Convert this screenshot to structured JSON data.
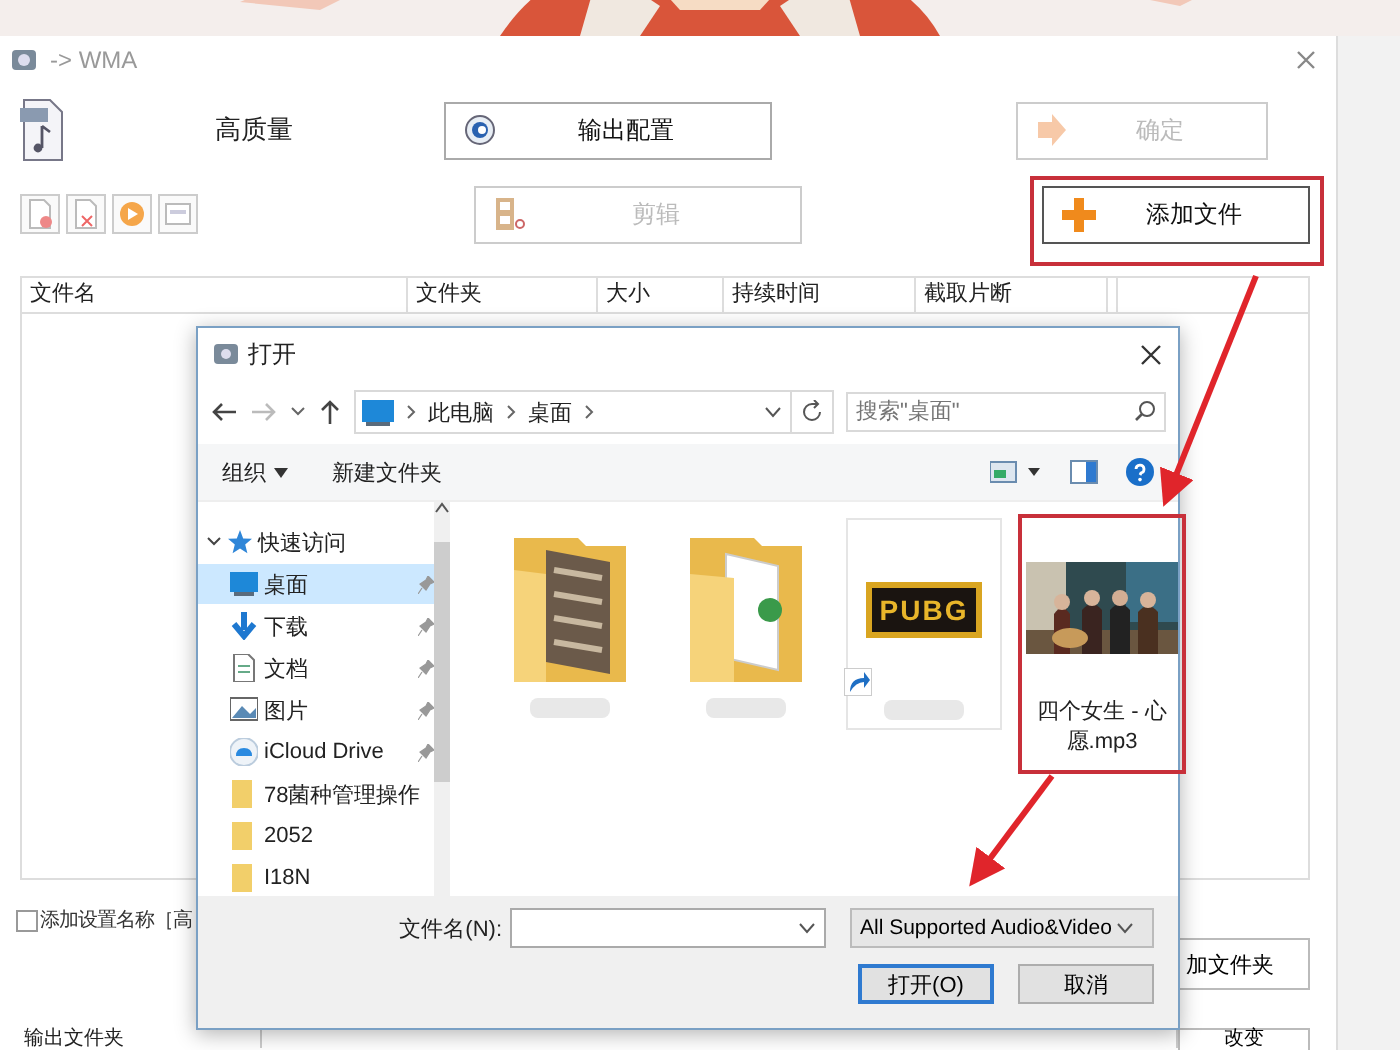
{
  "window": {
    "title": "-> WMA"
  },
  "quality_label": "高质量",
  "top_buttons": [
    {
      "kind": "config",
      "label": "输出配置",
      "disabled": false
    },
    {
      "kind": "confirm",
      "label": "确定",
      "disabled": true
    },
    {
      "kind": "clip",
      "label": "剪辑",
      "disabled": true
    },
    {
      "kind": "add",
      "label": "添加文件",
      "disabled": false
    }
  ],
  "table": {
    "columns": [
      "文件名",
      "文件夹",
      "大小",
      "持续时间",
      "截取片断"
    ]
  },
  "add_setting_name": {
    "label": "添加设置名称［高",
    "checked": false
  },
  "add_folder_button": "加文件夹",
  "output_folder": {
    "label": "输出文件夹",
    "change_button": "改变"
  },
  "dialog": {
    "title": "打开",
    "breadcrumb": [
      "此电脑",
      "桌面"
    ],
    "search": {
      "placeholder": "搜索\"桌面\""
    },
    "toolbar": {
      "organize": "组织",
      "new_folder": "新建文件夹"
    },
    "nav": [
      {
        "label": "快速访问",
        "kind": "quick",
        "expanded": true,
        "children": [
          {
            "label": "桌面",
            "kind": "desktop",
            "selected": true,
            "pinned": true
          },
          {
            "label": "下载",
            "kind": "download",
            "selected": false,
            "pinned": true
          },
          {
            "label": "文档",
            "kind": "document",
            "selected": false,
            "pinned": true
          },
          {
            "label": "图片",
            "kind": "pictures",
            "selected": false,
            "pinned": true
          },
          {
            "label": "iCloud Drive",
            "kind": "cloud",
            "selected": false,
            "pinned": true
          },
          {
            "label": "78菌种管理操作",
            "kind": "folder",
            "selected": false,
            "pinned": false
          },
          {
            "label": "2052",
            "kind": "folder",
            "selected": false,
            "pinned": false
          },
          {
            "label": "I18N",
            "kind": "folder",
            "selected": false,
            "pinned": false
          }
        ]
      }
    ],
    "files": [
      {
        "kind": "folder-photo"
      },
      {
        "kind": "folder-docs"
      },
      {
        "kind": "shortcut",
        "logo_text": "PUBG"
      },
      {
        "kind": "audio",
        "label": "四个女生 - 心愿.mp3"
      }
    ],
    "filename": {
      "label": "文件名(N):"
    },
    "filter": "All Supported Audio&Video",
    "open_button": "打开(O)",
    "cancel_button": "取消"
  }
}
